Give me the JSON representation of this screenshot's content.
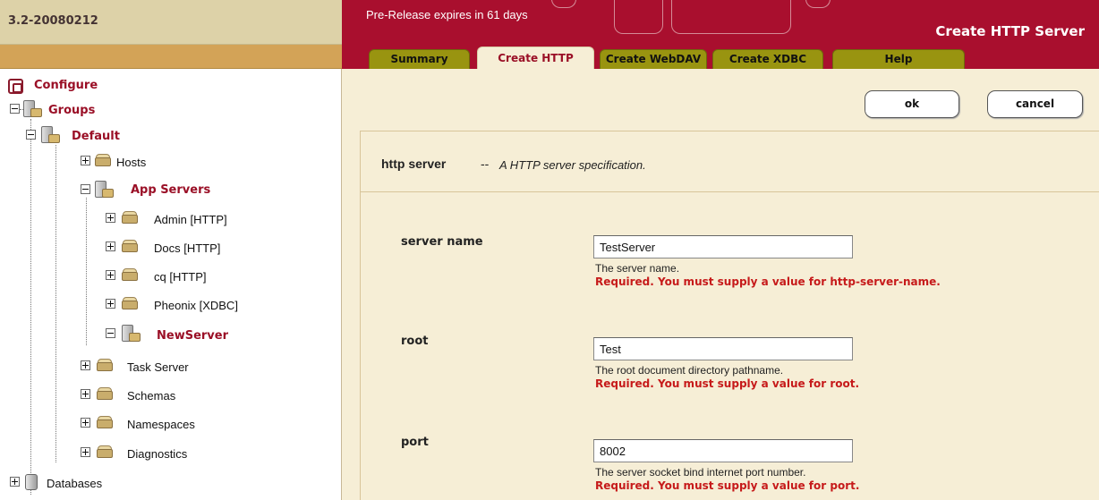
{
  "version": "3.2-20080212",
  "header": {
    "prerelease": "Pre-Release expires in 61 days",
    "page_title": "Create HTTP Server"
  },
  "tabs": [
    {
      "label": "Summary",
      "active": false
    },
    {
      "label": "Create HTTP",
      "active": true
    },
    {
      "label": "Create WebDAV",
      "active": false
    },
    {
      "label": "Create XDBC",
      "active": false
    },
    {
      "label": "Help",
      "active": false
    }
  ],
  "tree": {
    "configure": "Configure",
    "groups": "Groups",
    "default": "Default",
    "hosts": "Hosts",
    "app_servers": "App Servers",
    "servers": [
      "Admin [HTTP]",
      "Docs [HTTP]",
      "cq [HTTP]",
      "Pheonix [XDBC]"
    ],
    "new_server": "NewServer",
    "task_server": "Task Server",
    "schemas": "Schemas",
    "namespaces": "Namespaces",
    "diagnostics": "Diagnostics",
    "databases": "Databases"
  },
  "buttons": {
    "ok": "ok",
    "cancel": "cancel"
  },
  "panel": {
    "title": "http server",
    "separator": "--",
    "description": "A HTTP server specification."
  },
  "fields": [
    {
      "label": "server name",
      "value": "TestServer",
      "help": "The server name.",
      "error": "Required. You must supply a value for http-server-name."
    },
    {
      "label": "root",
      "value": "Test",
      "help": "The root document directory pathname.",
      "error": "Required. You must supply a value for root."
    },
    {
      "label": "port",
      "value": "8002",
      "help": "The server socket bind internet port number.",
      "error": "Required. You must supply a value for port."
    }
  ],
  "colors": {
    "brand": "#a90f2e",
    "tab": "#999410",
    "content_bg": "#f6eed6",
    "error": "#c61a1a"
  }
}
